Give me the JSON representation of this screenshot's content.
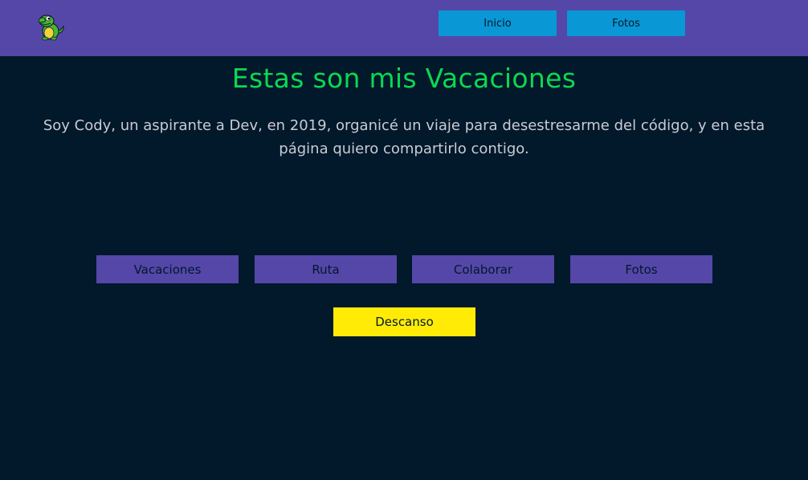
{
  "header": {
    "logo_icon": "crocodile-mascot-icon",
    "nav": [
      {
        "label": "Inicio"
      },
      {
        "label": "Fotos"
      }
    ]
  },
  "main": {
    "title": "Estas son mis Vacaciones",
    "intro": "Soy Cody, un aspirante a Dev, en 2019, organicé un viaje para desestresarme del código, y en esta página quiero compartirlo contigo.",
    "sections": [
      {
        "label": "Vacaciones"
      },
      {
        "label": "Ruta"
      },
      {
        "label": "Colaborar"
      },
      {
        "label": "Fotos"
      }
    ],
    "rest_button": "Descanso"
  },
  "colors": {
    "background": "#02182b",
    "header": "#5447a8",
    "nav_button": "#0997d5",
    "title": "#0ad951",
    "section_button": "#5447a8",
    "rest_button": "#ffeb05"
  }
}
